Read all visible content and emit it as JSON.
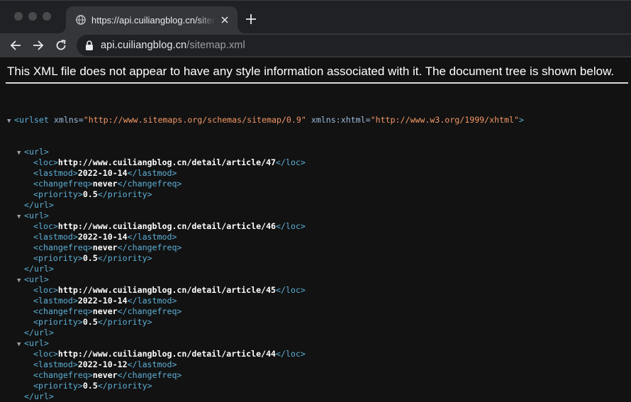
{
  "browser": {
    "tab_title": "https://api.cuiliangblog.cn/sitemap.xml",
    "url_host": "api.cuiliangblog.cn",
    "url_path": "/sitemap.xml"
  },
  "page": {
    "notice": "This XML file does not appear to have any style information associated with it. The document tree is shown below.",
    "root": {
      "open_tag": "<urlset",
      "attrs": [
        {
          "name": "xmlns",
          "value": "\"http://www.sitemaps.org/schemas/sitemap/0.9\""
        },
        {
          "name": "xmlns:xhtml",
          "value": "\"http://www.w3.org/1999/xhtml\""
        }
      ],
      "close_bracket": ">"
    },
    "url_open": "<url>",
    "url_close": "</url>",
    "entries": [
      {
        "loc": "http://www.cuiliangblog.cn/detail/article/47",
        "lastmod": "2022-10-14",
        "changefreq": "never",
        "priority": "0.5"
      },
      {
        "loc": "http://www.cuiliangblog.cn/detail/article/46",
        "lastmod": "2022-10-14",
        "changefreq": "never",
        "priority": "0.5"
      },
      {
        "loc": "http://www.cuiliangblog.cn/detail/article/45",
        "lastmod": "2022-10-14",
        "changefreq": "never",
        "priority": "0.5"
      },
      {
        "loc": "http://www.cuiliangblog.cn/detail/article/44",
        "lastmod": "2022-10-12",
        "changefreq": "never",
        "priority": "0.5"
      }
    ],
    "fields": [
      "loc",
      "lastmod",
      "changefreq",
      "priority"
    ]
  },
  "icons": {
    "tab_icon": "globe-icon",
    "close": "close-icon",
    "new_tab": "plus-icon",
    "back": "back-arrow-icon",
    "forward": "forward-arrow-icon",
    "reload": "reload-icon",
    "secure": "lock-icon",
    "expand": "triangle-down-icon"
  },
  "colors": {
    "tag": "#5db0d7",
    "attribute": "#9bbbdc",
    "attribute_value": "#f29766",
    "text": "#ffffff"
  }
}
